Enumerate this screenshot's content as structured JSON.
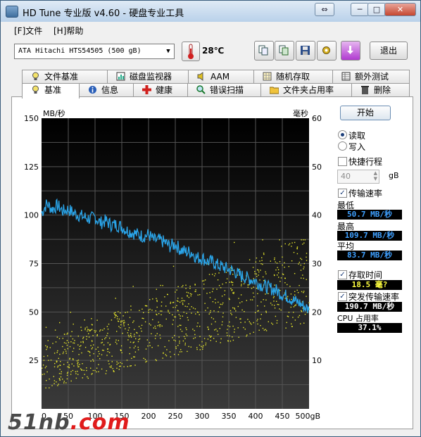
{
  "window": {
    "title": "HD Tune 专业版 v4.60 - 硬盘专业工具"
  },
  "title_buttons": {
    "nav": "⇔",
    "minimize": "─",
    "maximize": "□",
    "close": "✕"
  },
  "menu": [
    {
      "label": "[F]文件"
    },
    {
      "label": "[H]帮助"
    }
  ],
  "toolbar": {
    "drive": "ATA     Hitachi HTS54505 (500 gB)",
    "temperature": "28℃",
    "exit_label": "退出"
  },
  "tabs_row1": [
    {
      "label": "文件基准"
    },
    {
      "label": "磁盘监视器"
    },
    {
      "label": "AAM"
    },
    {
      "label": "随机存取"
    },
    {
      "label": "额外测试"
    }
  ],
  "tabs_row2": [
    {
      "label": "基准"
    },
    {
      "label": "信息"
    },
    {
      "label": "健康"
    },
    {
      "label": "错误扫描"
    },
    {
      "label": "文件夹占用率"
    },
    {
      "label": "删除"
    }
  ],
  "side": {
    "start_label": "开始",
    "read_label": "读取",
    "write_label": "写入",
    "short_stroke_label": "快捷行程",
    "short_stroke_value": "40",
    "short_stroke_unit": "gB",
    "transfer_label": "传输速率",
    "min_label": "最低",
    "min_value": "50.7 MB/秒",
    "max_label": "最高",
    "max_value": "109.7 MB/秒",
    "avg_label": "平均",
    "avg_value": "83.7 MB/秒",
    "access_label": "存取时间",
    "access_value": "18.5 毫?",
    "burst_label": "突发传输速率",
    "burst_value": "190.7 MB/秒",
    "cpu_label": "CPU 占用率",
    "cpu_value": "37.1%"
  },
  "colors": {
    "transfer_line": "#2aa4e8",
    "access_dots": "#e8e82a",
    "min_value": "#3fa0ff",
    "max_value": "#3fa0ff",
    "avg_value": "#3fa0ff",
    "access_value": "#ffff40",
    "burst_value": "#ffffff",
    "cpu_value": "#ffffff"
  },
  "watermark": {
    "text_a": "51nb",
    "text_b": ".com"
  },
  "chart_data": {
    "type": "line",
    "left_unit": "MB/秒",
    "right_unit": "毫秒",
    "x_unit": "gB",
    "xlim": [
      0,
      500
    ],
    "ylim": [
      0,
      150
    ],
    "y2lim": [
      0,
      60
    ],
    "x_ticks": [
      "0",
      "50",
      "100",
      "150",
      "200",
      "250",
      "300",
      "350",
      "400",
      "450",
      "500gB"
    ],
    "y_ticks": [
      "150",
      "125",
      "100",
      "75",
      "50",
      "25"
    ],
    "y2_ticks": [
      "60",
      "50",
      "40",
      "30",
      "20",
      "10"
    ],
    "series": [
      {
        "values_xy": [
          [
            0,
            101
          ],
          [
            10,
            106
          ],
          [
            20,
            103
          ],
          [
            30,
            105
          ],
          [
            40,
            102
          ],
          [
            50,
            103
          ],
          [
            60,
            101
          ],
          [
            70,
            100
          ],
          [
            80,
            99
          ],
          [
            90,
            98
          ],
          [
            100,
            99
          ],
          [
            110,
            96
          ],
          [
            120,
            97
          ],
          [
            130,
            95
          ],
          [
            140,
            95
          ],
          [
            150,
            94
          ],
          [
            160,
            92
          ],
          [
            170,
            91
          ],
          [
            180,
            90
          ],
          [
            190,
            89
          ],
          [
            200,
            90
          ],
          [
            210,
            87
          ],
          [
            220,
            87
          ],
          [
            230,
            86
          ],
          [
            240,
            84
          ],
          [
            250,
            85
          ],
          [
            260,
            82
          ],
          [
            270,
            81
          ],
          [
            280,
            81
          ],
          [
            290,
            78
          ],
          [
            300,
            78
          ],
          [
            310,
            76
          ],
          [
            320,
            76
          ],
          [
            330,
            74
          ],
          [
            340,
            73
          ],
          [
            350,
            72
          ],
          [
            360,
            71
          ],
          [
            370,
            69
          ],
          [
            380,
            68
          ],
          [
            390,
            67
          ],
          [
            400,
            66
          ],
          [
            410,
            64
          ],
          [
            420,
            63
          ],
          [
            430,
            62
          ],
          [
            440,
            61
          ],
          [
            450,
            59
          ],
          [
            460,
            58
          ],
          [
            470,
            56
          ],
          [
            480,
            55
          ],
          [
            490,
            53
          ],
          [
            500,
            51
          ]
        ]
      }
    ],
    "access_scatter": {
      "x_range": [
        0,
        500
      ],
      "y_ms_range": [
        4,
        35
      ]
    },
    "grid": true,
    "background": "#000000"
  }
}
